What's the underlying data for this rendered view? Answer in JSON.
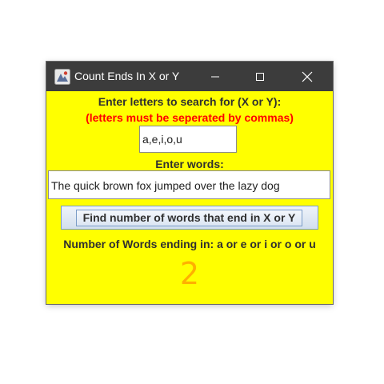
{
  "window": {
    "title": "Count Ends In X or Y"
  },
  "form": {
    "letters_prompt": "Enter letters to search for (X or Y):",
    "letters_note": "(letters must be seperated by commas)",
    "letters_value": "a,e,i,o,u",
    "words_prompt": "Enter words:",
    "words_value": "The quick brown fox jumped over the lazy dog",
    "find_button_label": "Find number of words that end in X or Y",
    "result_label": "Number of Words ending in: a or e or i or o or u",
    "result_count": "2"
  },
  "colors": {
    "background": "#ffff00",
    "titlebar": "#3c3c3c",
    "note_text": "#ff0000",
    "result_count": "#ffb000"
  },
  "icons": [
    "app-icon",
    "minimize-icon",
    "maximize-icon",
    "close-icon"
  ]
}
